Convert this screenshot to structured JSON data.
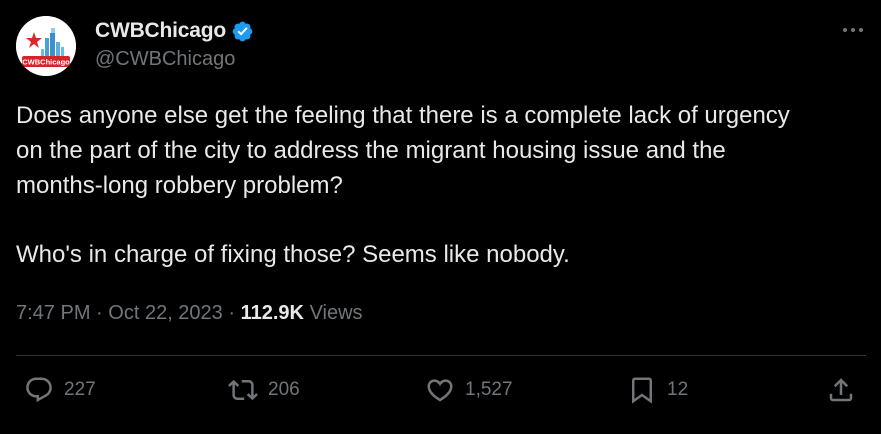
{
  "tweet": {
    "display_name": "CWBChicago",
    "handle": "@CWBChicago",
    "avatar_text": "CWBChicago",
    "body_line1": "Does anyone else get the feeling that there is a complete lack of urgency",
    "body_line2": "on the part of the city to address the migrant housing issue and the",
    "body_line3": "months-long robbery problem?",
    "body_line4": "Who's in charge of fixing those? Seems like nobody.",
    "time": "7:47 PM",
    "separator": "·",
    "date": "Oct 22, 2023",
    "views_count": "112.9K",
    "views_label": "Views"
  },
  "actions": {
    "replies": "227",
    "reposts": "206",
    "likes": "1,527",
    "bookmarks": "12"
  },
  "icons": {
    "verified": "verified-badge-icon",
    "more": "more-options-icon",
    "reply": "reply-icon",
    "repost": "repost-icon",
    "like": "heart-icon",
    "bookmark": "bookmark-icon",
    "share": "share-icon"
  },
  "colors": {
    "background": "#000000",
    "primary_text": "#e7e9ea",
    "secondary_text": "#71767b",
    "verified_blue": "#1d9bf0",
    "divider": "#2f3336"
  }
}
